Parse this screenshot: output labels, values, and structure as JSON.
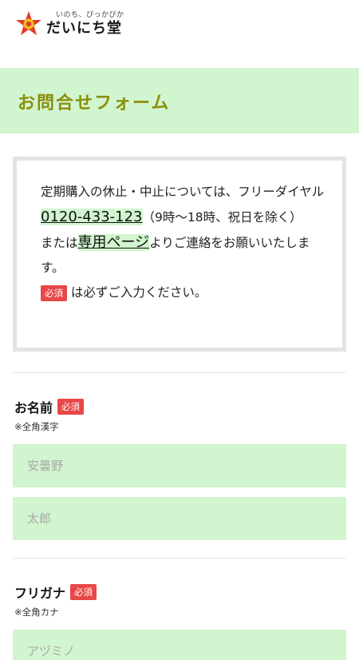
{
  "header": {
    "logo_tagline": "いのち、ぴっかぴか",
    "logo_name": "だいにち堂",
    "logo_icon": "star-logo-icon"
  },
  "page_title": "お問合せフォーム",
  "notice": {
    "line1_text": "定期購入の休止・中止については、フリーダイヤル",
    "phone_link": "0120-433-123",
    "line1_suffix": "（9時〜18時、祝日を除く）",
    "line2_prefix": "または",
    "page_link": "専用ページ",
    "line2_suffix": "よりご連絡をお願いいたします。",
    "required_badge": "必須",
    "required_note": " は必ずご入力ください。"
  },
  "fields": {
    "name": {
      "label": "お名前",
      "required_badge": "必須",
      "note": "※全角漢字",
      "last_placeholder": "安曇野",
      "first_placeholder": "太郎"
    },
    "furigana": {
      "label": "フリガナ",
      "required_badge": "必須",
      "note": "※全角カナ",
      "last_placeholder": "アヅミノ"
    }
  },
  "colors": {
    "accent_green": "#d1f5cf",
    "title_olive": "#8a8f0a",
    "required_red": "#e84747"
  }
}
